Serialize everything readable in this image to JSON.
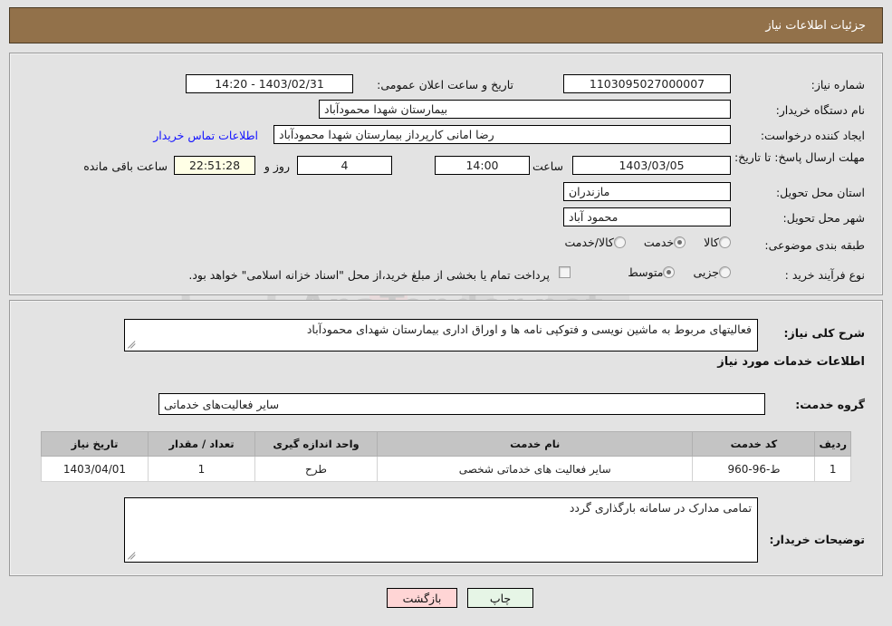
{
  "header": {
    "title": "جزئیات اطلاعات نیاز"
  },
  "top_form": {
    "need_number_label": "شماره نیاز:",
    "need_number_value": "1103095027000007",
    "public_announce_label": "تاریخ و ساعت اعلان عمومی:",
    "public_announce_value": "1403/02/31 - 14:20",
    "buyer_org_label": "نام دستگاه خریدار:",
    "buyer_org_value": "بیمارستان شهدا محمودآباد",
    "creator_label": "ایجاد کننده درخواست:",
    "creator_value": "رضا امانی کارپرداز بیمارستان شهدا محمودآباد",
    "contact_link": "اطلاعات تماس خریدار",
    "deadline_label": "مهلت ارسال پاسخ: تا تاریخ:",
    "deadline_date": "1403/03/05",
    "hour_label": "ساعت",
    "deadline_time": "14:00",
    "days_value": "4",
    "days_label": "روز و",
    "countdown_value": "22:51:28",
    "remaining_label": "ساعت باقی مانده",
    "province_label": "استان محل تحویل:",
    "province_value": "مازندران",
    "city_label": "شهر محل تحویل:",
    "city_value": "محمود آباد",
    "category_label": "طبقه بندی موضوعی:",
    "category_options": [
      {
        "label": "کالا",
        "selected": false
      },
      {
        "label": "خدمت",
        "selected": true
      },
      {
        "label": "کالا/خدمت",
        "selected": false
      }
    ],
    "process_label": "نوع فرآیند خرید :",
    "process_options": [
      {
        "label": "جزیی",
        "selected": false
      },
      {
        "label": "متوسط",
        "selected": true
      }
    ],
    "treasury_checkbox_text": "پرداخت تمام یا بخشی از مبلغ خرید،از محل \"اسناد خزانه اسلامی\" خواهد بود.",
    "treasury_checked": false
  },
  "middle": {
    "general_desc_label": "شرح کلی نیاز:",
    "general_desc_value": "فعالیتهای مربوط به ماشین نویسی و فتوکپی نامه ها و اوراق اداری  بیمارستان شهدای محمودآباد",
    "services_section_title": "اطلاعات خدمات مورد نیاز",
    "service_group_label": "گروه خدمت:",
    "service_group_value": "سایر فعالیت‌های خدماتی",
    "buyer_notes_label": "توضیحات خریدار:",
    "buyer_notes_value": "تمامی مدارک در سامانه بارگذاری گردد"
  },
  "table": {
    "headers": [
      "ردیف",
      "کد خدمت",
      "نام خدمت",
      "واحد اندازه گیری",
      "تعداد / مقدار",
      "تاریخ نیاز"
    ],
    "rows": [
      {
        "row_no": "1",
        "service_code": "ط-96-960",
        "service_name": "سایر فعالیت های خدماتی شخصی",
        "unit": "طرح",
        "quantity": "1",
        "need_date": "1403/04/01"
      }
    ]
  },
  "footer": {
    "back_label": "بازگشت",
    "print_label": "چاپ"
  },
  "watermark": {
    "text": "AnaTender.net"
  },
  "colors": {
    "header_bg": "#92714a",
    "link": "#1414ff",
    "back_btn": "#ffd5d5",
    "print_btn": "#e6f5e6",
    "countdown_bg": "#ffffe6",
    "table_header_bg": "#c4c4c4"
  }
}
